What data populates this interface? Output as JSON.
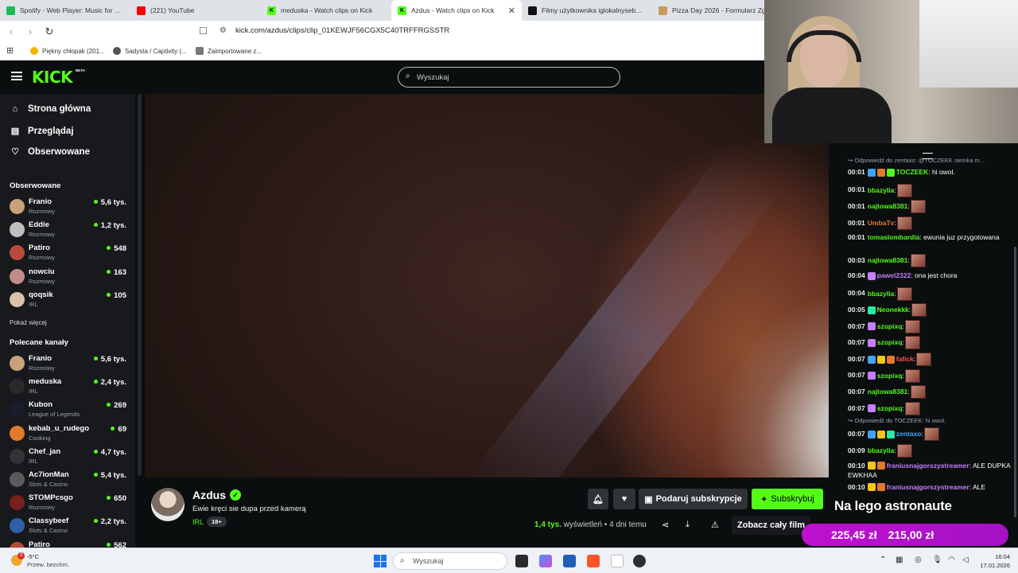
{
  "browser": {
    "tabs": [
      {
        "label": "Spotify - Web Player: Music for every...",
        "color": "#1db954",
        "glyph": ""
      },
      {
        "label": "(221) YouTube",
        "color": "#ff0000",
        "glyph": ""
      },
      {
        "label": "meduska - Watch clips on Kick",
        "color": "#53fc18",
        "glyph": "K"
      },
      {
        "label": "Azdus - Watch clips on Kick",
        "color": "#53fc18",
        "glyph": "K",
        "active": true
      },
      {
        "label": "Filmy użytkownika iglokalnyseba (@...",
        "color": "#111111",
        "glyph": ""
      },
      {
        "label": "Pizza Day 2026 - Formularz Zgło...",
        "color": "#c89b5b",
        "glyph": ""
      }
    ],
    "tab_close": "✕",
    "url": "kick.com/azdus/clips/clip_01KEWJF56CGX5C40TRFFRGSSTR",
    "bookmarks": [
      {
        "label": "Piękny chłopak (201...",
        "color": "#f4b400"
      },
      {
        "label": "Sadysta / Captivity (...",
        "color": "#555555"
      },
      {
        "label": "Zaimportowane z...",
        "color": "#777777"
      }
    ]
  },
  "header": {
    "logo": "KICK",
    "logo_badge": "BETA",
    "search_placeholder": "Wyszukaj"
  },
  "sidebar": {
    "nav": [
      {
        "label": "Strona główna",
        "icon": "home-icon",
        "glyph": "⌂"
      },
      {
        "label": "Przeglądaj",
        "icon": "browse-icon",
        "glyph": "▤"
      },
      {
        "label": "Obserwowane",
        "icon": "heart-icon",
        "glyph": "♡"
      }
    ],
    "followed_heading": "Obserwowane",
    "followed": [
      {
        "name": "Franio",
        "category": "Rozmowy",
        "viewers": "5,6 tys.",
        "color": "#c9a27b"
      },
      {
        "name": "Eddie",
        "category": "Rozmowy",
        "viewers": "1,2 tys.",
        "color": "#bfbfbf"
      },
      {
        "name": "Patiro",
        "category": "Rozmowy",
        "viewers": "548",
        "color": "#b84a3c"
      },
      {
        "name": "nowciu",
        "category": "Rozmowy",
        "viewers": "163",
        "color": "#c08b8b"
      },
      {
        "name": "qoqsik",
        "category": "IRL",
        "viewers": "105",
        "color": "#d9c2a6"
      }
    ],
    "show_more": "Pokaż więcej",
    "recommended_heading": "Polecane kanały",
    "recommended": [
      {
        "name": "Franio",
        "category": "Rozmowy",
        "viewers": "5,6 tys.",
        "color": "#c9a27b"
      },
      {
        "name": "meduska",
        "category": "IRL",
        "viewers": "2,4 tys.",
        "color": "#2a2a2a"
      },
      {
        "name": "Kubon",
        "category": "League of Legends",
        "viewers": "269",
        "color": "#1b1b2e"
      },
      {
        "name": "kebab_u_rudego",
        "category": "Cooking",
        "viewers": "69",
        "color": "#e07b2a"
      },
      {
        "name": "Chef_jan",
        "category": "IRL",
        "viewers": "4,7 tys.",
        "color": "#333333"
      },
      {
        "name": "Ac7ionMan",
        "category": "Slots & Casino",
        "viewers": "5,4 tys.",
        "color": "#5a5a5a"
      },
      {
        "name": "STOMPcsgo",
        "category": "Rozmowy",
        "viewers": "650",
        "color": "#7a1f1f"
      },
      {
        "name": "Classybeef",
        "category": "Slots & Casino",
        "viewers": "2,2 tys.",
        "color": "#2f5fa8"
      },
      {
        "name": "Patiro",
        "category": "",
        "viewers": "562",
        "color": "#b84a3c"
      }
    ]
  },
  "clip": {
    "channel": "Azdus",
    "verified_glyph": "✓",
    "title": "Ewie kręci sie dupa przed kamerą",
    "category": "IRL",
    "age": "18+",
    "gift_label": "Podaruj subskrypcje",
    "subscribe_label": "Subskrybuj",
    "views": "1,4 tys.",
    "views_word": "wyświetleń",
    "dot": "•",
    "posted": "4 dni temu",
    "full_video_label": "Zobacz cały film"
  },
  "chat": {
    "messages": [
      {
        "type": "reply",
        "text": "↪ Odpowiedź do zentaxo: @TOCZEEK siemka m..."
      },
      {
        "time": "00:01",
        "user": "TOCZEEK",
        "color": "#53fc18",
        "text": ": hi owol.",
        "emote": false,
        "badges": [
          "#3fa3ff",
          "#e07b2a",
          "#53fc18"
        ]
      },
      {
        "time": "00:01",
        "user": "bbazylia",
        "color": "#53fc18",
        "text": ":",
        "emote": true,
        "badges": []
      },
      {
        "time": "00:01",
        "user": "najtowa8381",
        "color": "#53fc18",
        "text": ":",
        "emote": true,
        "badges": []
      },
      {
        "time": "00:01",
        "user": "UmbaTv",
        "color": "#e07b2a",
        "text": ":",
        "emote": true,
        "badges": []
      },
      {
        "time": "00:01",
        "user": "tomaslombardia",
        "color": "#53fc18",
        "text": ": ewunia juz przygotowana",
        "emote": false,
        "badges": []
      },
      {
        "time": "00:03",
        "user": "najtowa8381",
        "color": "#53fc18",
        "text": ":",
        "emote": true,
        "badges": []
      },
      {
        "time": "00:04",
        "user": "pawel2322",
        "color": "#c77dff",
        "text": ": ona jest chora",
        "emote": false,
        "badges": [
          "#c77dff"
        ]
      },
      {
        "time": "00:04",
        "user": "bbazylia",
        "color": "#53fc18",
        "text": ":",
        "emote": true,
        "badges": []
      },
      {
        "time": "00:05",
        "user": "Neonekkk",
        "color": "#53fc18",
        "text": ":",
        "emote": true,
        "badges": [
          "#2ee6a6"
        ]
      },
      {
        "time": "00:07",
        "user": "szopixq",
        "color": "#53fc18",
        "text": ":",
        "emote": true,
        "badges": [
          "#c77dff"
        ]
      },
      {
        "time": "00:07",
        "user": "szopixq",
        "color": "#53fc18",
        "text": ":",
        "emote": true,
        "badges": [
          "#c77dff"
        ]
      },
      {
        "time": "00:07",
        "user": "fafick",
        "color": "#ff4d4d",
        "text": ":",
        "emote": true,
        "badges": [
          "#3fa3ff",
          "#f5c518",
          "#e07b2a"
        ]
      },
      {
        "time": "00:07",
        "user": "szopixq",
        "color": "#53fc18",
        "text": ":",
        "emote": true,
        "badges": [
          "#c77dff"
        ]
      },
      {
        "time": "00:07",
        "user": "najtowa8381",
        "color": "#53fc18",
        "text": ":",
        "emote": true,
        "badges": []
      },
      {
        "time": "00:07",
        "user": "szopixq",
        "color": "#53fc18",
        "text": ":",
        "emote": true,
        "badges": [
          "#c77dff"
        ]
      },
      {
        "type": "reply",
        "text": "↪ Odpowiedź do TOCZEEK: hi owol."
      },
      {
        "time": "00:07",
        "user": "zentaxo",
        "color": "#3fa3ff",
        "text": ":",
        "emote": true,
        "badges": [
          "#3fa3ff",
          "#f5c518",
          "#2ee6a6"
        ]
      },
      {
        "time": "00:09",
        "user": "bbazylia",
        "color": "#53fc18",
        "text": ":",
        "emote": true,
        "badges": []
      },
      {
        "time": "00:10",
        "user": "franiusnajgorszystreamer",
        "color": "#c77dff",
        "text": ": ALE DUPKA EWKHAA",
        "emote": false,
        "badges": [
          "#f5c518",
          "#e07b2a"
        ]
      },
      {
        "time": "00:10",
        "user": "franiusnajgorszystreamer",
        "color": "#c77dff",
        "text": ": ALE",
        "emote": false,
        "badges": [
          "#f5c518",
          "#e07b2a"
        ]
      }
    ]
  },
  "overlay": {
    "caption": "Na lego astronaute",
    "amount_1": "225,45 zł",
    "amount_2": "215,00 zł"
  },
  "taskbar": {
    "weather_badge": "3",
    "temperature": "-5°C",
    "weather_desc": "Przew. bezchm.",
    "search_placeholder": "Wyszukaj",
    "time": "16:04",
    "date": "17.01.2026"
  }
}
